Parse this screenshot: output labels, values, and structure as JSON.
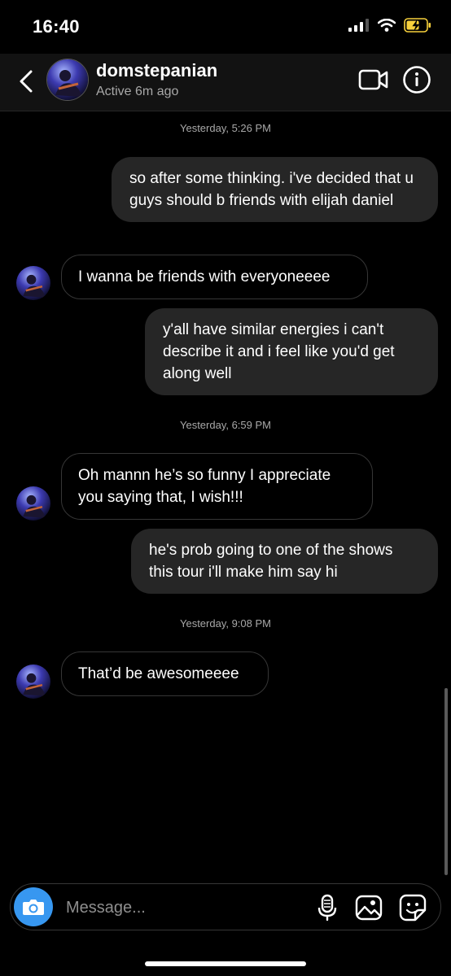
{
  "status_bar": {
    "time": "16:40"
  },
  "header": {
    "username": "domstepanian",
    "status": "Active 6m ago"
  },
  "messages": [
    {
      "stamp": "Yesterday, 5:26 PM"
    },
    {
      "type": "sent",
      "text": "so after some thinking. i've decided that u guys should b friends with elijah daniel"
    },
    {
      "type": "received",
      "text": "I wanna be friends with everyoneeee"
    },
    {
      "type": "sent",
      "text": "y'all have similar energies i can't describe it and i feel like you'd get along well"
    },
    {
      "stamp": "Yesterday, 6:59 PM"
    },
    {
      "type": "received",
      "text": "Oh mannn he’s so funny I appreciate you saying that, I wish!!!"
    },
    {
      "type": "sent",
      "text": "he's prob going to one of the shows this tour i'll make him say hi"
    },
    {
      "stamp": "Yesterday, 9:08 PM"
    },
    {
      "type": "received",
      "text": "That’d be awesomeeee"
    }
  ],
  "composer": {
    "placeholder": "Message..."
  },
  "icons": {
    "back": "chevron-left-icon",
    "video": "video-call-icon",
    "info": "info-icon",
    "camera": "camera-icon",
    "mic": "microphone-icon",
    "gallery": "gallery-icon",
    "sticker": "sticker-icon"
  },
  "colors": {
    "sent_bubble": "#262626",
    "accent": "#3797f0",
    "battery": "#f7d13c"
  }
}
